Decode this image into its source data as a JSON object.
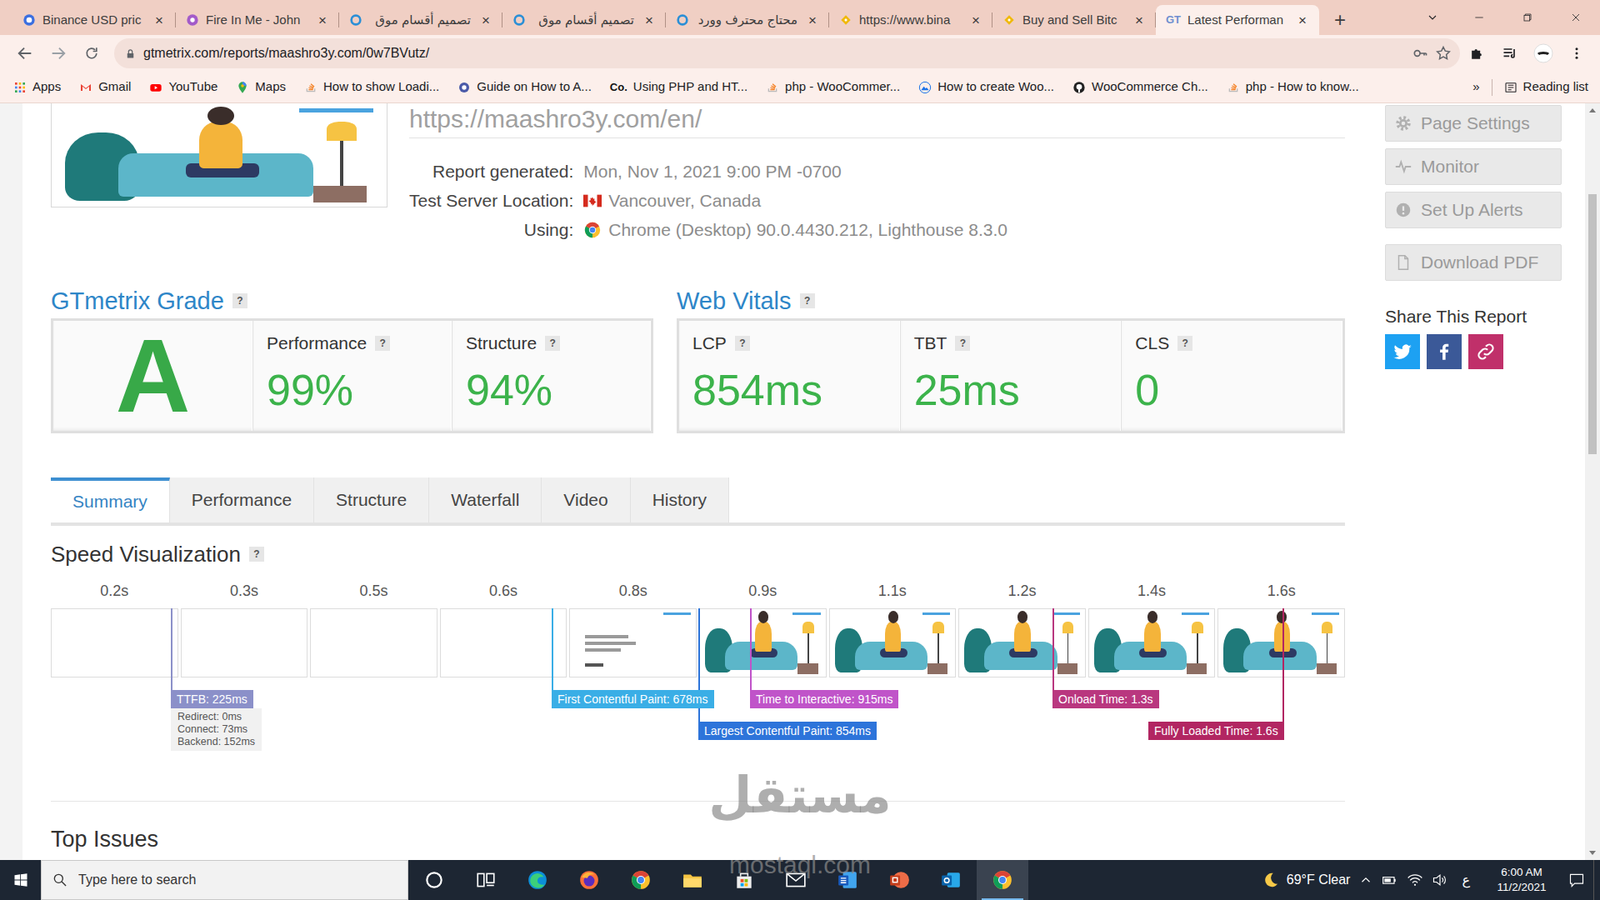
{
  "browser": {
    "tabs": [
      {
        "label": "Binance USD pric",
        "selected": false,
        "kind": "coin"
      },
      {
        "label": "Fire In Me - John",
        "selected": false,
        "kind": "music"
      },
      {
        "label": "تصميم أقسام موق",
        "selected": false,
        "kind": "mostaql"
      },
      {
        "label": "تصميم أقسام موق",
        "selected": false,
        "kind": "mostaql"
      },
      {
        "label": "محتاج محترف وورد",
        "selected": false,
        "kind": "mostaql"
      },
      {
        "label": "https://www.bina",
        "selected": false,
        "kind": "binance"
      },
      {
        "label": "Buy and Sell Bitc",
        "selected": false,
        "kind": "binance"
      },
      {
        "label": "Latest Performan",
        "selected": true,
        "kind": "gtmetrix",
        "icon_text": "GT"
      }
    ],
    "tab_close": "×",
    "new_tab": "+",
    "address": "gtmetrix.com/reports/maashro3y.com/0w7BVutz/",
    "bookmarks": [
      {
        "label": "Apps",
        "kind": "apps"
      },
      {
        "label": "Gmail",
        "kind": "gmail"
      },
      {
        "label": "YouTube",
        "kind": "youtube"
      },
      {
        "label": "Maps",
        "kind": "maps"
      },
      {
        "label": "How to show Loadi...",
        "kind": "stack"
      },
      {
        "label": "Guide on How to A...",
        "kind": "guide"
      },
      {
        "label": "Using PHP and HT...",
        "kind": "co",
        "icon_text": "Co."
      },
      {
        "label": "php - WooCommer...",
        "kind": "stack"
      },
      {
        "label": "How to create Woo...",
        "kind": "mountain"
      },
      {
        "label": "WooCommerce Ch...",
        "kind": "github"
      },
      {
        "label": "php - How to know...",
        "kind": "stack"
      }
    ],
    "bookmarks_more": "»",
    "reading_list": "Reading list"
  },
  "page": {
    "url_heading": "https://maashro3y.com/en/",
    "info": [
      {
        "label": "Report generated:",
        "value": "Mon, Nov 1, 2021 9:00 PM -0700",
        "kind": "plain"
      },
      {
        "label": "Test Server Location:",
        "value": "Vancouver, Canada",
        "kind": "flag"
      },
      {
        "label": "Using:",
        "value": "Chrome (Desktop) 90.0.4430.212, Lighthouse 8.3.0",
        "kind": "chrome"
      }
    ],
    "grade": {
      "title": "GTmetrix Grade",
      "help": "?",
      "letter": "A",
      "metrics": [
        {
          "label": "Performance",
          "help": "?",
          "value": "99%"
        },
        {
          "label": "Structure",
          "help": "?",
          "value": "94%"
        }
      ]
    },
    "vitals": {
      "title": "Web Vitals",
      "help": "?",
      "metrics": [
        {
          "label": "LCP",
          "help": "?",
          "value": "854ms"
        },
        {
          "label": "TBT",
          "help": "?",
          "value": "25ms"
        },
        {
          "label": "CLS",
          "help": "?",
          "value": "0"
        }
      ]
    },
    "report_tabs": [
      {
        "label": "Summary",
        "selected": true
      },
      {
        "label": "Performance",
        "selected": false
      },
      {
        "label": "Structure",
        "selected": false
      },
      {
        "label": "Waterfall",
        "selected": false
      },
      {
        "label": "Video",
        "selected": false
      },
      {
        "label": "History",
        "selected": false
      }
    ],
    "speed": {
      "title": "Speed Visualization",
      "help": "?",
      "ticks": [
        "0.2s",
        "0.3s",
        "0.5s",
        "0.6s",
        "0.8s",
        "0.9s",
        "1.1s",
        "1.2s",
        "1.4s",
        "1.6s"
      ],
      "frames": [
        {
          "kind": "blank"
        },
        {
          "kind": "blank"
        },
        {
          "kind": "blank"
        },
        {
          "kind": "blank"
        },
        {
          "kind": "text"
        },
        {
          "kind": "image"
        },
        {
          "kind": "image"
        },
        {
          "kind": "image"
        },
        {
          "kind": "image"
        },
        {
          "kind": "image"
        }
      ],
      "markers": [
        {
          "label": "TTFB: 225ms",
          "level": 0.093,
          "color": "#8b90c9",
          "details": [
            "Redirect: 0ms",
            "Connect: 73ms",
            "Backend: 152ms"
          ]
        },
        {
          "label": "First Contentful Paint: 678ms",
          "level": 0.387,
          "color": "#3aaee6"
        },
        {
          "label": "Largest Contentful Paint: 854ms",
          "level": 0.5,
          "color": "#2d74da"
        },
        {
          "label": "Time to Interactive: 915ms",
          "level": 0.54,
          "color": "#c054c9"
        },
        {
          "label": "Onload Time: 1.3s",
          "level": 0.774,
          "color": "#b9377f"
        },
        {
          "label": "Fully Loaded Time: 1.6s",
          "level": 0.952,
          "color": "#b22662"
        }
      ]
    },
    "top_issues": "Top Issues"
  },
  "sidebar": {
    "buttons": [
      {
        "label": "Page Settings",
        "kind": "gear"
      },
      {
        "label": "Monitor",
        "kind": "pulse"
      },
      {
        "label": "Set Up Alerts",
        "kind": "alert"
      },
      {
        "label": "Download PDF",
        "kind": "pdf"
      }
    ],
    "share_title": "Share This Report",
    "share": [
      {
        "kind": "twitter",
        "color": "#1da1f2"
      },
      {
        "kind": "facebook",
        "color": "#3b5998"
      },
      {
        "kind": "link",
        "color": "#c0306a"
      }
    ]
  },
  "taskbar": {
    "search_placeholder": "Type here to search",
    "apps": [
      {
        "kind": "cortana",
        "active": false
      },
      {
        "kind": "taskview",
        "active": false
      },
      {
        "kind": "edge",
        "active": false
      },
      {
        "kind": "firefox",
        "active": false
      },
      {
        "kind": "chrome",
        "active": false
      },
      {
        "kind": "explorer",
        "active": false
      },
      {
        "kind": "store",
        "active": false
      },
      {
        "kind": "mail",
        "active": false
      },
      {
        "kind": "word",
        "active": false
      },
      {
        "kind": "powerpoint",
        "active": false
      },
      {
        "kind": "outlook",
        "active": false
      },
      {
        "kind": "chrome",
        "active": true
      }
    ],
    "weather": "69°F Clear",
    "language": "ع",
    "time": "6:00 AM",
    "date": "11/2/2021"
  },
  "watermark": {
    "logo": "مستقل",
    "site": "mostaql.com"
  }
}
